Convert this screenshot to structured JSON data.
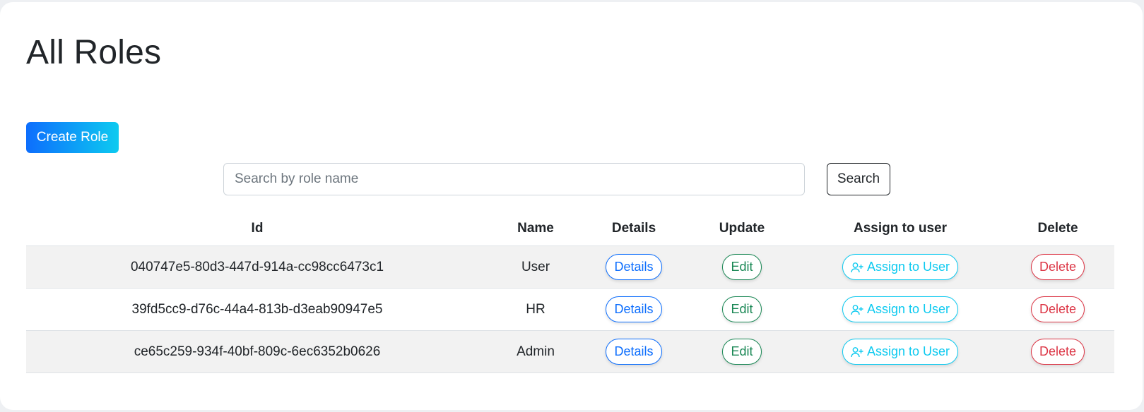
{
  "page": {
    "title": "All Roles"
  },
  "actions": {
    "create_label": "Create Role"
  },
  "search": {
    "placeholder": "Search by role name",
    "value": "",
    "button_label": "Search"
  },
  "table": {
    "headers": [
      "Id",
      "Name",
      "Details",
      "Update",
      "Assign to user",
      "Delete"
    ],
    "rows": [
      {
        "id": "040747e5-80d3-447d-914a-cc98cc6473c1",
        "name": "User"
      },
      {
        "id": "39fd5cc9-d76c-44a4-813b-d3eab90947e5",
        "name": "HR"
      },
      {
        "id": "ce65c259-934f-40bf-809c-6ec6352b0626",
        "name": "Admin"
      }
    ],
    "row_actions": {
      "details_label": "Details",
      "edit_label": "Edit",
      "assign_label": "Assign to User",
      "delete_label": "Delete"
    }
  },
  "icons": {
    "assign": "person-plus-icon"
  },
  "colors": {
    "primary": "#0d6efd",
    "info": "#0dcaf0",
    "success": "#198754",
    "danger": "#dc3545",
    "stripe": "#f2f2f2"
  }
}
